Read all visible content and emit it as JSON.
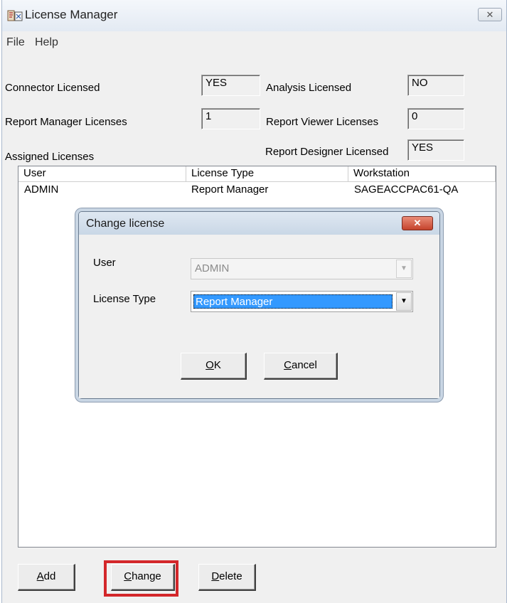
{
  "window": {
    "title": "License Manager",
    "close_symbol": "✕"
  },
  "menu": [
    {
      "label": "File"
    },
    {
      "label": "Help"
    }
  ],
  "fields": {
    "connector_label": "Connector Licensed",
    "connector_value": "YES",
    "analysis_label": "Analysis Licensed",
    "analysis_value": "NO",
    "report_manager_label": "Report Manager Licenses",
    "report_manager_value": "1",
    "report_viewer_label": "Report Viewer Licenses",
    "report_viewer_value": "0",
    "report_designer_label": "Report Designer Licensed",
    "report_designer_value": "YES",
    "assigned_label": "Assigned Licenses"
  },
  "table": {
    "columns": [
      "User",
      "License Type",
      "Workstation"
    ],
    "rows": [
      [
        "ADMIN",
        "Report Manager",
        "SAGEACCPAC61-QA"
      ]
    ]
  },
  "dialog": {
    "title": "Change license",
    "close_symbol": "✕",
    "user_label": "User",
    "user_value": "ADMIN",
    "license_label": "License Type",
    "license_value": "Report Manager",
    "ok_mnemonic": "O",
    "ok_rest": "K",
    "cancel_mnemonic": "C",
    "cancel_rest": "ancel"
  },
  "buttons": {
    "add_mnemonic": "A",
    "add_rest": "dd",
    "change_mnemonic": "C",
    "change_rest": "hange",
    "delete_mnemonic": "D",
    "delete_rest": "elete"
  },
  "colors": {
    "highlight": "#d3272a",
    "selection": "#3399ff",
    "dialog_close": "#c5432c"
  },
  "icons": {
    "app": "license-app-icon",
    "dropdown": "chevron-down-icon"
  }
}
